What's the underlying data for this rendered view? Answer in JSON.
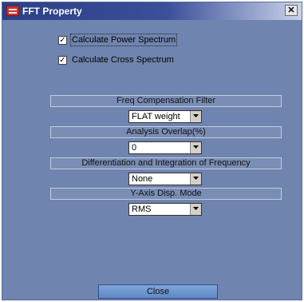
{
  "window": {
    "title": "FFT Property",
    "close_glyph": "✕"
  },
  "checkboxes": [
    {
      "label": "Calculate Power Spectrum",
      "checked": true
    },
    {
      "label": "Calculate Cross Spectrum",
      "checked": true
    }
  ],
  "sections": [
    {
      "label": "Freq Compensation Filter",
      "value": "FLAT weight"
    },
    {
      "label": "Analysis Overlap(%)",
      "value": "0"
    },
    {
      "label": "Differentiation and Integration of Frequency",
      "value": "None"
    },
    {
      "label": "Y-Axis Disp. Mode",
      "value": "RMS"
    }
  ],
  "buttons": {
    "close_label": "Close"
  },
  "icons": {
    "title": "fft-app-icon",
    "dropdown": "chevron-down-icon",
    "check": "checkmark-icon"
  }
}
